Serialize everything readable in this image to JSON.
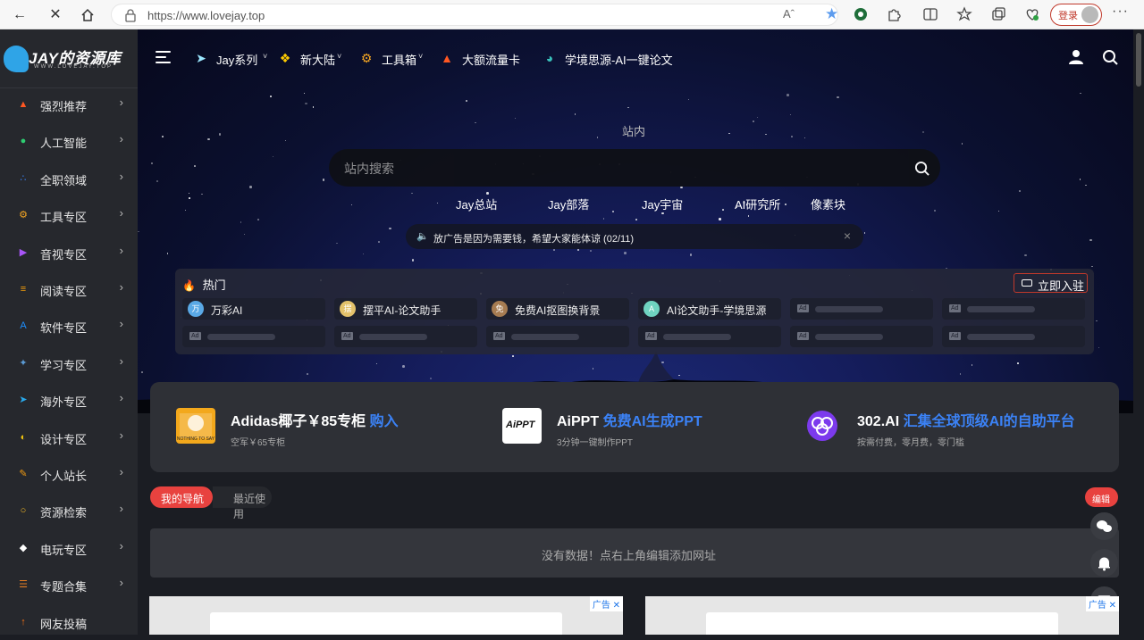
{
  "browser": {
    "url": "https://www.lovejay.top",
    "login_label": "登录",
    "read_aloud": "Aˆ",
    "more": "···"
  },
  "sidebar": {
    "logo_text": "JAY的资源库",
    "logo_sub": "WWW.LOVEJAY.TOP",
    "items": [
      {
        "label": "强烈推荐",
        "icon": "fire-icon",
        "color": "#ff5722"
      },
      {
        "label": "人工智能",
        "icon": "robot-icon",
        "color": "#2ecc71"
      },
      {
        "label": "全职领域",
        "icon": "network-icon",
        "color": "#3b82f6"
      },
      {
        "label": "工具专区",
        "icon": "gear-icon",
        "color": "#f5a623"
      },
      {
        "label": "音视专区",
        "icon": "video-icon",
        "color": "#a855f7"
      },
      {
        "label": "阅读专区",
        "icon": "book-icon",
        "color": "#f59e0b"
      },
      {
        "label": "软件专区",
        "icon": "appstore-icon",
        "color": "#1e90ff"
      },
      {
        "label": "学习专区",
        "icon": "study-icon",
        "color": "#5b9bd5"
      },
      {
        "label": "海外专区",
        "icon": "telegram-icon",
        "color": "#29a9eb"
      },
      {
        "label": "设计专区",
        "icon": "palette-icon",
        "color": "#f1c40f"
      },
      {
        "label": "个人站长",
        "icon": "pen-icon",
        "color": "#f39c12"
      },
      {
        "label": "资源检索",
        "icon": "search-icon",
        "color": "#fbbf24"
      },
      {
        "label": "电玩专区",
        "icon": "ghost-icon",
        "color": "#ffffff"
      },
      {
        "label": "专题合集",
        "icon": "stack-icon",
        "color": "#e67e22"
      },
      {
        "label": "网友投稿",
        "icon": "upload-icon",
        "color": "#f97316"
      }
    ]
  },
  "nav": {
    "items": [
      {
        "label": "Jay系列",
        "icon": "paper-plane-icon",
        "dropdown": true
      },
      {
        "label": "新大陆",
        "icon": "grid-icon",
        "dropdown": true
      },
      {
        "label": "工具箱",
        "icon": "gear-icon",
        "dropdown": true
      },
      {
        "label": "大额流量卡",
        "icon": "fire-icon",
        "dropdown": false
      },
      {
        "label": "学境思源-AI一键论文",
        "icon": "logo-icon",
        "dropdown": false
      }
    ]
  },
  "search": {
    "scope_label": "站内",
    "placeholder": "站内搜索",
    "quick_links": [
      "Jay总站",
      "Jay部落",
      "Jay宇宙",
      "AI研究所",
      "像素块"
    ]
  },
  "notice": {
    "text": "放广告是因为需要钱，希望大家能体谅 (02/11)"
  },
  "hot": {
    "title": "热门",
    "join_label": "立即入驻",
    "row1": [
      {
        "avatar": "万",
        "label": "万彩AI",
        "color": "#5aa9e6"
      },
      {
        "avatar": "摆",
        "label": "摆平AI-论文助手",
        "color": "#e3c26b"
      },
      {
        "avatar": "免",
        "label": "免费AI抠图换背景",
        "color": "#a67c52"
      },
      {
        "avatar": "A",
        "label": "AI论文助手-学境思源",
        "color": "#6fd3c0"
      }
    ],
    "ad_label": "Ad"
  },
  "ads": [
    {
      "title": "Adidas椰子￥85专柜",
      "highlight": "购入",
      "sub": "空军￥65专柜",
      "brand": "NOTHING TO SAY"
    },
    {
      "title": "AiPPT",
      "highlight": "免费AI生成PPT",
      "sub": "3分钟一键制作PPT",
      "brand": "AiPPT"
    },
    {
      "title": "302.AI",
      "highlight": "汇集全球顶级AI的自助平台",
      "sub": "按需付费，零月费，零门槛",
      "brand": "302"
    }
  ],
  "tabs": {
    "mine": "我的导航",
    "recent": "最近使用",
    "edit": "编辑"
  },
  "empty_text": "没有数据！点右上角编辑添加网址",
  "ad_tag": "广告"
}
